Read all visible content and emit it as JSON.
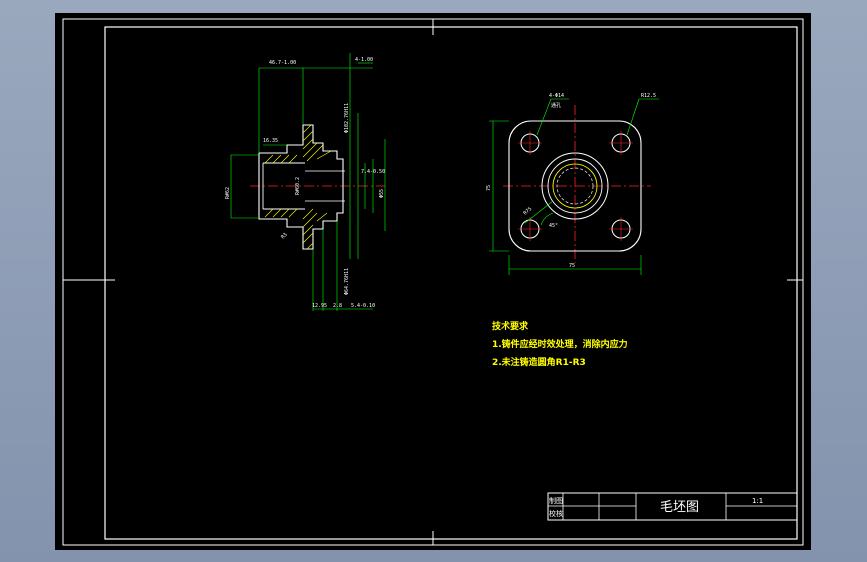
{
  "colors": {
    "background": "#8e9db5",
    "sheet": "#000000",
    "frame": "#ffffff",
    "dimension": "#00ff00",
    "centerline": "#ff2020",
    "part": "#ffffff",
    "hatch": "#ffff00",
    "notes": "#ffff00"
  },
  "side_view": {
    "dims": {
      "top_length": "46.7-1.00",
      "top_right": "4-1.00",
      "left_small": "16.35",
      "left_height": "R#62",
      "bore": "R#60.2",
      "step": "7.4-0.50",
      "radius_small": "R3",
      "outer_dia": "Φ55",
      "bottom_length": "12.95",
      "bottom_mid": "2.8",
      "bottom_right": "5.4-0.10",
      "vert_top": "Φ102.76H11",
      "vert_bottom": "Φ64.76H11"
    }
  },
  "front_view": {
    "dims": {
      "holes": "4-Φ14",
      "holes_note": "通孔",
      "corner_radius": "R12.5",
      "height": "75",
      "width": "75",
      "pitch": "R75",
      "angle": "45°"
    }
  },
  "notes": {
    "heading": "技术要求",
    "items": [
      "1.铸件应经时效处理，消除内应力",
      "2.未注铸造圆角R1-R3"
    ]
  },
  "title_block": {
    "drawn_label": "制图",
    "checked_label": "校核",
    "drawing_name": "毛坯图",
    "scale": "1:1"
  }
}
